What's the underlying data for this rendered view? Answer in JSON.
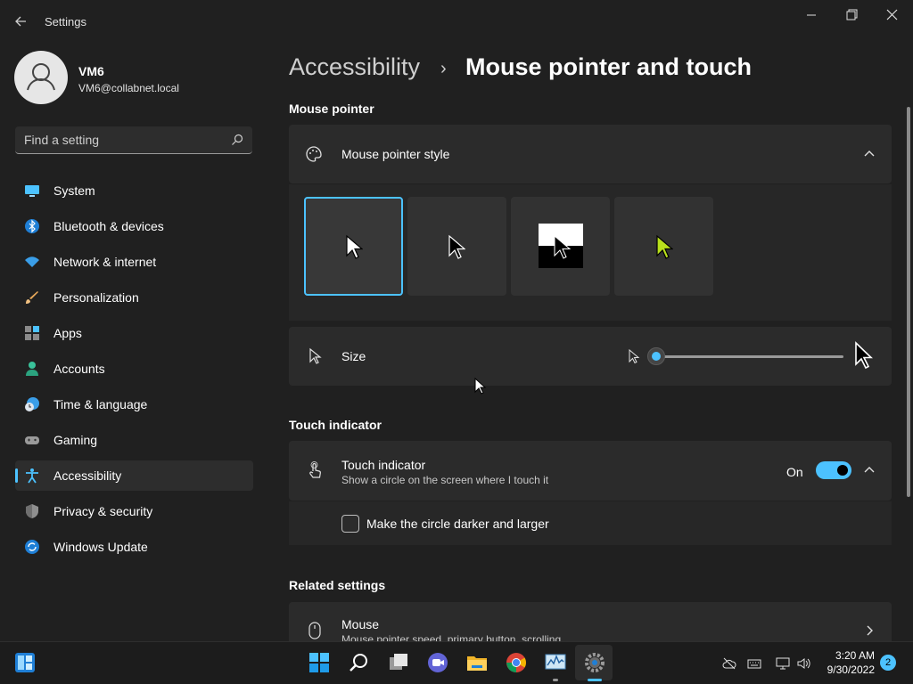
{
  "window": {
    "title": "Settings"
  },
  "user": {
    "name": "VM6",
    "email": "VM6@collabnet.local"
  },
  "search": {
    "placeholder": "Find a setting"
  },
  "sidebar": {
    "items": [
      {
        "label": "System",
        "icon": "system-icon"
      },
      {
        "label": "Bluetooth & devices",
        "icon": "bluetooth-icon"
      },
      {
        "label": "Network & internet",
        "icon": "wifi-icon"
      },
      {
        "label": "Personalization",
        "icon": "brush-icon"
      },
      {
        "label": "Apps",
        "icon": "apps-icon"
      },
      {
        "label": "Accounts",
        "icon": "accounts-icon"
      },
      {
        "label": "Time & language",
        "icon": "clock-globe-icon"
      },
      {
        "label": "Gaming",
        "icon": "gamepad-icon"
      },
      {
        "label": "Accessibility",
        "icon": "accessibility-icon",
        "active": true
      },
      {
        "label": "Privacy & security",
        "icon": "shield-icon"
      },
      {
        "label": "Windows Update",
        "icon": "update-icon"
      }
    ]
  },
  "breadcrumb": {
    "parent": "Accessibility",
    "separator": "›",
    "current": "Mouse pointer and touch"
  },
  "mouse_pointer": {
    "heading": "Mouse pointer",
    "style_label": "Mouse pointer style",
    "styles": [
      "white",
      "black",
      "inverted",
      "custom"
    ],
    "selected_style": "white",
    "size_label": "Size",
    "size_value": 0.0
  },
  "touch": {
    "heading": "Touch indicator",
    "title": "Touch indicator",
    "description": "Show a circle on the screen where I touch it",
    "state": "On",
    "checkbox_label": "Make the circle darker and larger",
    "checked": false
  },
  "related": {
    "heading": "Related settings",
    "mouse_title": "Mouse",
    "mouse_desc": "Mouse pointer speed, primary button, scrolling"
  },
  "taskbar": {
    "time": "3:20 AM",
    "date": "9/30/2022",
    "notifications": "2",
    "apps": [
      "start-icon",
      "search-icon",
      "task-view-icon",
      "chat-icon",
      "file-explorer-icon",
      "chrome-icon",
      "performance-monitor-icon",
      "settings-icon"
    ]
  },
  "colors": {
    "accent": "#4cc2ff",
    "background": "#202020",
    "card": "#2b2b2b",
    "custom_pointer": "#b8e01c"
  }
}
